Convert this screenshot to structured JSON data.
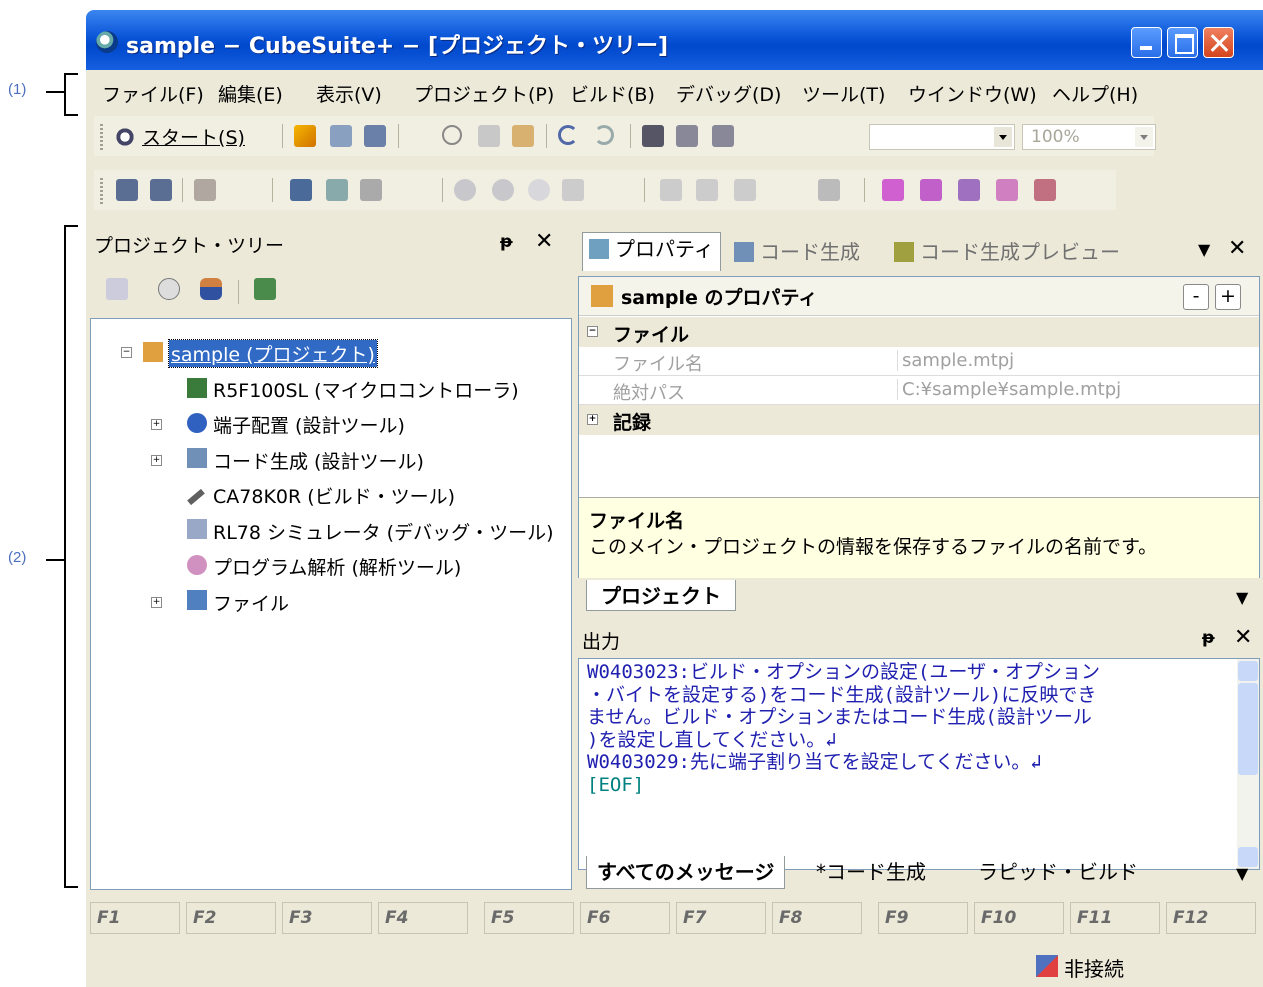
{
  "callouts": {
    "one": "(1)",
    "two": "(2)"
  },
  "window": {
    "title": "sample − CubeSuite+ − [プロジェクト・ツリー]"
  },
  "menu": [
    "ファイル(F)",
    "編集(E)",
    "表示(V)",
    "プロジェクト(P)",
    "ビルド(B)",
    "デバッグ(D)",
    "ツール(T)",
    "ウインドウ(W)",
    "ヘルプ(H)"
  ],
  "toolbar": {
    "start_label": "スタート(S)",
    "zoom_value": "100%"
  },
  "tree_panel": {
    "title": "プロジェクト・ツリー",
    "pin": "ᵽ",
    "close": "✕",
    "nodes": [
      {
        "label": "sample (プロジェクト)",
        "icon": "project-icon"
      },
      {
        "label": "R5F100SL (マイクロコントローラ)",
        "icon": "chip-icon"
      },
      {
        "label": "端子配置 (設計ツール)",
        "icon": "pin-config-icon"
      },
      {
        "label": "コード生成 (設計ツール)",
        "icon": "code-gen-icon"
      },
      {
        "label": "CA78K0R (ビルド・ツール)",
        "icon": "hammer-icon"
      },
      {
        "label": "RL78 シミュレータ (デバッグ・ツール)",
        "icon": "debugger-icon"
      },
      {
        "label": "プログラム解析 (解析ツール)",
        "icon": "analysis-icon"
      },
      {
        "label": "ファイル",
        "icon": "folder-icon"
      }
    ]
  },
  "doc_tabs": [
    "プロパティ",
    "コード生成",
    "コード生成プレビュー"
  ],
  "properties": {
    "header": "sample のプロパティ",
    "minus": "-",
    "plus": "+",
    "category_file": "ファイル",
    "rows": [
      {
        "name": "ファイル名",
        "value": "sample.mtpj"
      },
      {
        "name": "絶対パス",
        "value": "C:¥sample¥sample.mtpj"
      }
    ],
    "category_record": "記録",
    "desc_title": "ファイル名",
    "desc_text": "このメイン・プロジェクトの情報を保存するファイルの名前です。",
    "bottom_tab": "プロジェクト"
  },
  "output": {
    "title": "出力",
    "lines": [
      "W0403023:ビルド・オプションの設定(ユーザ・オプション",
      "・バイトを設定する)をコード生成(設計ツール)に反映でき",
      "ません。ビルド・オプションまたはコード生成(設計ツール",
      ")を設定し直してください。↲",
      "W0403029:先に端子割り当てを設定してください。↲",
      "[EOF]"
    ],
    "tabs": [
      "すべてのメッセージ",
      "*コード生成",
      "ラピッド・ビルド"
    ]
  },
  "fkeys": [
    "F1",
    "F2",
    "F3",
    "F4",
    "F5",
    "F6",
    "F7",
    "F8",
    "F9",
    "F10",
    "F11",
    "F12"
  ],
  "status": {
    "connection": "非接続"
  }
}
